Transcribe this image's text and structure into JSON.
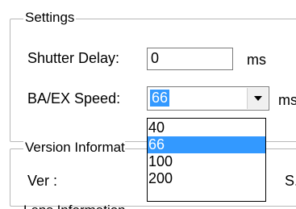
{
  "settings_group": {
    "title": "Settings",
    "shutter_delay": {
      "label": "Shutter Delay:",
      "value": "0",
      "unit": "ms"
    },
    "ba_ex_speed": {
      "label": "BA/EX Speed:",
      "selected": "66",
      "unit": "ms",
      "options": [
        "40",
        "66",
        "100",
        "200"
      ],
      "selected_index": 1
    }
  },
  "version_group": {
    "title_visible": "Version Informat",
    "ver_label": "Ver :",
    "right_label_visible": "S."
  },
  "bottom_group": {
    "title_partial": "Lens Information"
  },
  "colors": {
    "selection": "#3399ff",
    "group_border": "#b8b8b8"
  },
  "icons": {
    "dropdown_arrow": "chevron-down-icon"
  }
}
